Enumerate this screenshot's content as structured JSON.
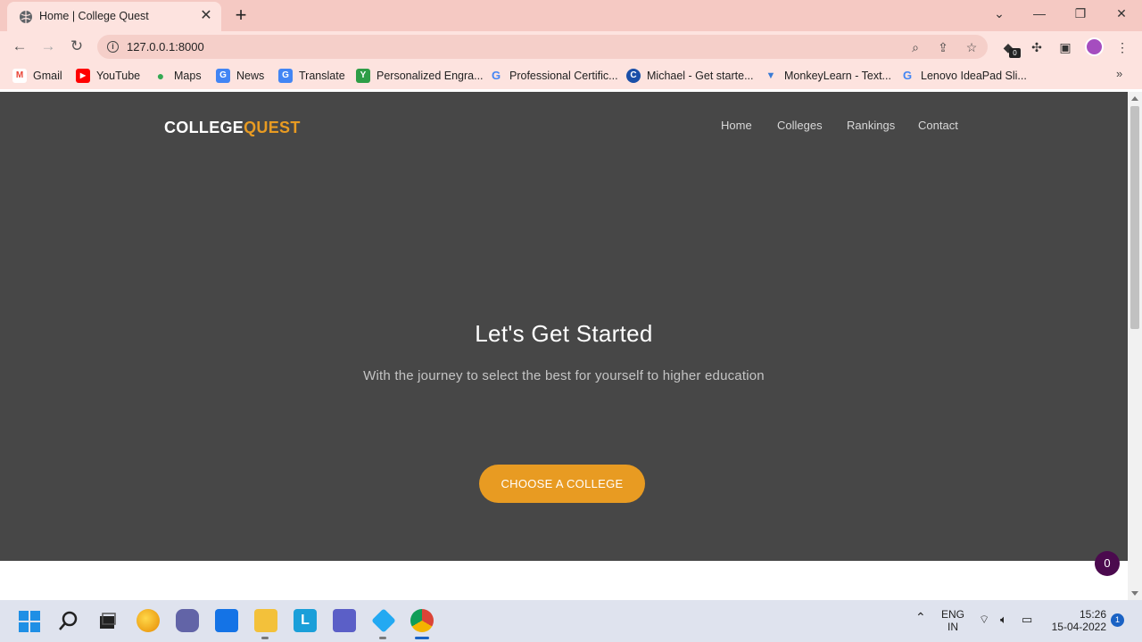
{
  "browser": {
    "tab_title": "Home | College Quest",
    "tab_close": "✕",
    "new_tab": "+",
    "url": "127.0.0.1:8000",
    "extension_badge": "0",
    "bookmarks": [
      {
        "label": "Gmail",
        "icon": "gmail-icon",
        "color": "#ea4335",
        "glyph": "M"
      },
      {
        "label": "YouTube",
        "icon": "youtube-icon",
        "color": "#ff0000",
        "glyph": "▶"
      },
      {
        "label": "Maps",
        "icon": "maps-icon",
        "color": "#34a853",
        "glyph": "●"
      },
      {
        "label": "News",
        "icon": "news-icon",
        "color": "#4285f4",
        "glyph": "G"
      },
      {
        "label": "Translate",
        "icon": "translate-icon",
        "color": "#4285f4",
        "glyph": "G"
      },
      {
        "label": "Personalized Engra...",
        "icon": "engrave-icon",
        "color": "#2e9d46",
        "glyph": "Y"
      },
      {
        "label": "Professional Certific...",
        "icon": "google-icon",
        "color": "#4285f4",
        "glyph": "G"
      },
      {
        "label": "Michael - Get starte...",
        "icon": "c-icon",
        "color": "#1a4fa8",
        "glyph": "C"
      },
      {
        "label": "MonkeyLearn - Text...",
        "icon": "monkeylearn-icon",
        "color": "#3a7bd5",
        "glyph": "▼"
      },
      {
        "label": "Lenovo IdeaPad Sli...",
        "icon": "google-icon",
        "color": "#4285f4",
        "glyph": "G"
      }
    ]
  },
  "page": {
    "brand_part1": "COLLEGE",
    "brand_part2": "QUEST",
    "nav": [
      "Home",
      "Colleges",
      "Rankings",
      "Contact"
    ],
    "hero_title": "Let's Get Started",
    "hero_subtitle": "With the journey to select the best for yourself to higher education",
    "cta_label": "CHOOSE A COLLEGE",
    "chat_badge_count": "0"
  },
  "taskbar": {
    "lang_line1": "ENG",
    "lang_line2": "IN",
    "time": "15:26",
    "date": "15-04-2022",
    "notifications": "1"
  },
  "colors": {
    "accent": "#e89b22",
    "hero_bg": "#474747",
    "chrome_bg": "#f5c9c3"
  }
}
